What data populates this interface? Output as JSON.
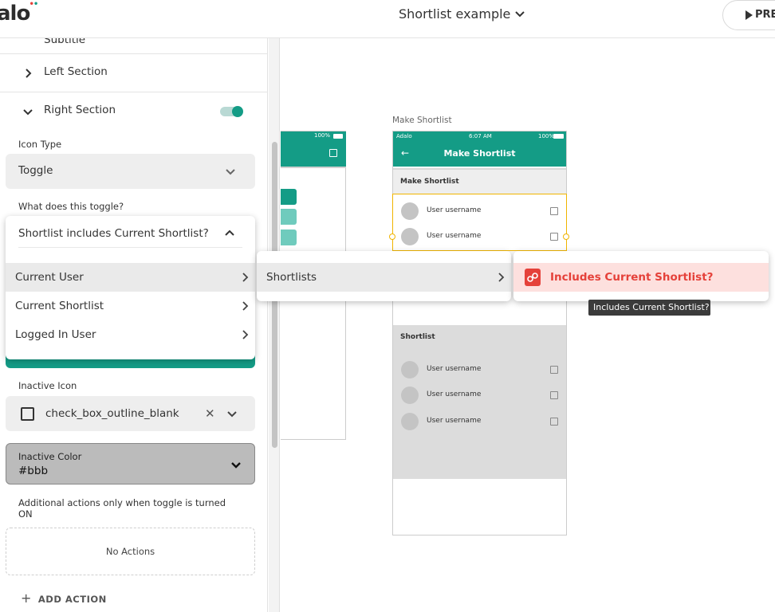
{
  "header": {
    "logo": "alo",
    "app_title": "Shortlist example",
    "preview_label": "PRE"
  },
  "panel": {
    "subtitle_row_label": "Subtitle",
    "left_section_label": "Left Section",
    "right_section_label": "Right Section",
    "right_section_toggle_on": true,
    "icon_type_label": "Icon Type",
    "icon_type_value": "Toggle",
    "toggle_target_label": "What does this toggle?",
    "toggle_target_value": "Shortlist includes Current Shortlist?",
    "inactive_icon_label": "Inactive Icon",
    "inactive_icon_value": "check_box_outline_blank",
    "inactive_color_label": "Inactive Color",
    "inactive_color_value": "#bbb",
    "additional_actions_label": "Additional actions only when toggle is turned ON",
    "no_actions_label": "No Actions",
    "add_action_label": "ADD ACTION"
  },
  "dropdown": {
    "items": [
      {
        "label": "Current User"
      },
      {
        "label": "Current Shortlist"
      },
      {
        "label": "Logged In User"
      }
    ],
    "submenu_item": "Shortlists",
    "submenu2_item": "Includes Current Shortlist?",
    "tooltip": "Includes Current Shortlist?"
  },
  "canvas": {
    "left_screen_status": "100%",
    "screen_title": "Make Shortlist",
    "phone": {
      "carrier": "Adalo",
      "time": "6:07 AM",
      "battery": "100%",
      "title": "Make Shortlist",
      "section1_title": "Make Shortlist",
      "section2_title": "Shortlist",
      "user_label": "User username"
    }
  },
  "colors": {
    "brand": "#149c86",
    "danger": "#e5413a",
    "selection": "#f0b400"
  }
}
